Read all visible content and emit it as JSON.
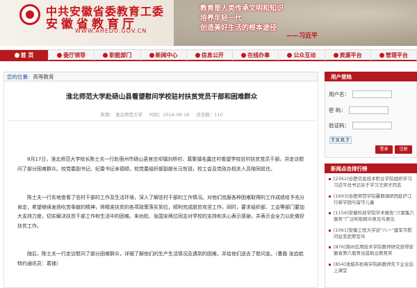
{
  "header": {
    "title_line1": "中共安徽省委教育工委",
    "title_line2": "安徽省教育厅",
    "url": "WWW.AHEDU.GOV.CN",
    "slogan": [
      "教育是人类传承文明和知识",
      "培养年轻一代",
      "创造美好生活的根本途径"
    ],
    "signature": "——习近平"
  },
  "nav": [
    {
      "label": "首 页",
      "active": true
    },
    {
      "label": "委厅领导"
    },
    {
      "label": "职能部门"
    },
    {
      "label": "新闻中心"
    },
    {
      "label": "信息公开"
    },
    {
      "label": "在线办事"
    },
    {
      "label": "公众互动"
    },
    {
      "label": "资源平台"
    },
    {
      "label": "管理平台"
    }
  ],
  "breadcrumb": {
    "label": "您的位置:",
    "value": "高等教育"
  },
  "article": {
    "title": "淮北师范大学赴砀山县看望慰问学校驻村扶贫党员干部和困难群众",
    "source": "来源： 淮北师范大学",
    "time": "时间：2018-08-18",
    "clicks": "点击数：110",
    "paragraphs": [
      "8月17日，淮北师范大学校长陈士夫一行赴宿州市砀山县官庄坝镇刘桥村、葛集镇毛露庄村看望学校驻村扶贫党员干部，并走访慰问了部分困难群众。校党委副书记、纪委书记未德顺，校党委组织部副部长马哲锐，校工会及党政办相关人员陪同前往。",
      "陈士夫一行实地查看了驻村干部的工作及生活环境，深入了解驻村干部的工作情况。对他们克服各种困难取得的工作成绩给予充分肯定，希望继续发扬吃苦奉献的精神，将精准扶贫的各项政策落实到位，顺利完成脱贫攻坚工作。同时，要求组织部、工会等部门要加大支持力度，切实解决扶贫干部工作和生活中的困难。朱劝松、张国安两位同志对学校的支持和关心表示感谢，并表示会全力以赴做好扶贫工作。",
      "随后，陈士夫一行走访慰问了部分困难群众，详细了解他们的生产生活情况及遇到的困难，并给他们送去了慰问金。（曹磊  张启航  特约通讯员：葛揉）"
    ]
  },
  "login": {
    "title": "用户登陆",
    "username_label": "用户名：",
    "password_label": "密  码：",
    "code_label": "验证码：",
    "captcha": "TXR7",
    "buttons": [
      "登录",
      "注册"
    ]
  },
  "ranking": {
    "title": "新闻点击排行榜",
    "items": [
      "[2362]合肥信息技术职业学院组织学习习近平总书记关于学习王继才同志",
      "[1693]合肥师范学院暑期调研团赴庐江行新学园与留守儿童",
      "[1156]安徽科技学院学术报告“六聚集六服务”广泛听取群众意见与意见",
      "[1061]安徽工程大学迎“八一”建军节慰问驻芜武警官兵",
      "[876]滁州应用技术学院教师研究获得安徽省第六届青出蓝助业教育奖",
      "[854]淮城市机电学院新教师先下企业后上课堂"
    ]
  }
}
